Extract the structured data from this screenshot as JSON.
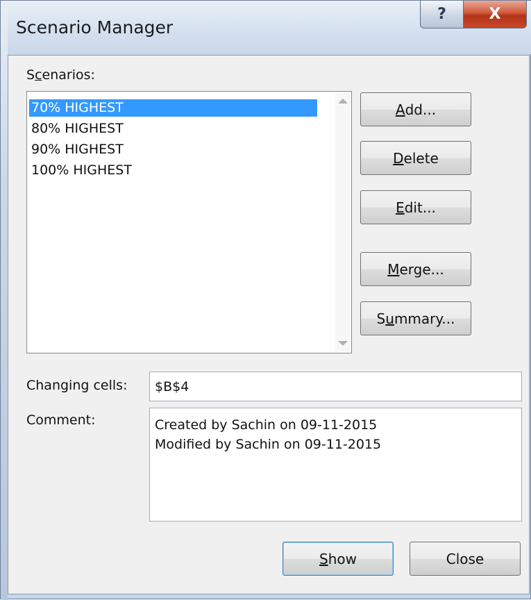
{
  "window": {
    "title": "Scenario Manager",
    "help_label": "?",
    "close_label": "X"
  },
  "scenarios": {
    "label_pre": "S",
    "label_accel": "c",
    "label_post": "enarios:",
    "items": [
      "70% HIGHEST",
      "80% HIGHEST",
      "90% HIGHEST",
      "100% HIGHEST"
    ],
    "selected_index": 0
  },
  "buttons": {
    "add": {
      "accel": "A",
      "rest": "dd..."
    },
    "delete": {
      "accel": "D",
      "rest": "elete"
    },
    "edit": {
      "accel": "E",
      "rest": "dit..."
    },
    "merge": {
      "accel": "M",
      "rest": "erge..."
    },
    "summary": {
      "pre": "S",
      "accel": "u",
      "rest": "mmary..."
    },
    "show": {
      "accel": "S",
      "rest": "how"
    },
    "close": "Close"
  },
  "changing_cells": {
    "label": "Changing cells:",
    "value": "$B$4"
  },
  "comment": {
    "label": "Comment:",
    "lines": [
      "Created by Sachin on 09-11-2015",
      "Modified by Sachin on 09-11-2015"
    ]
  },
  "colors": {
    "selection": "#3399ff",
    "title_bar": "#d5e1ef",
    "close_button": "#c9472a",
    "dialog_bg": "#f0f0f0"
  }
}
